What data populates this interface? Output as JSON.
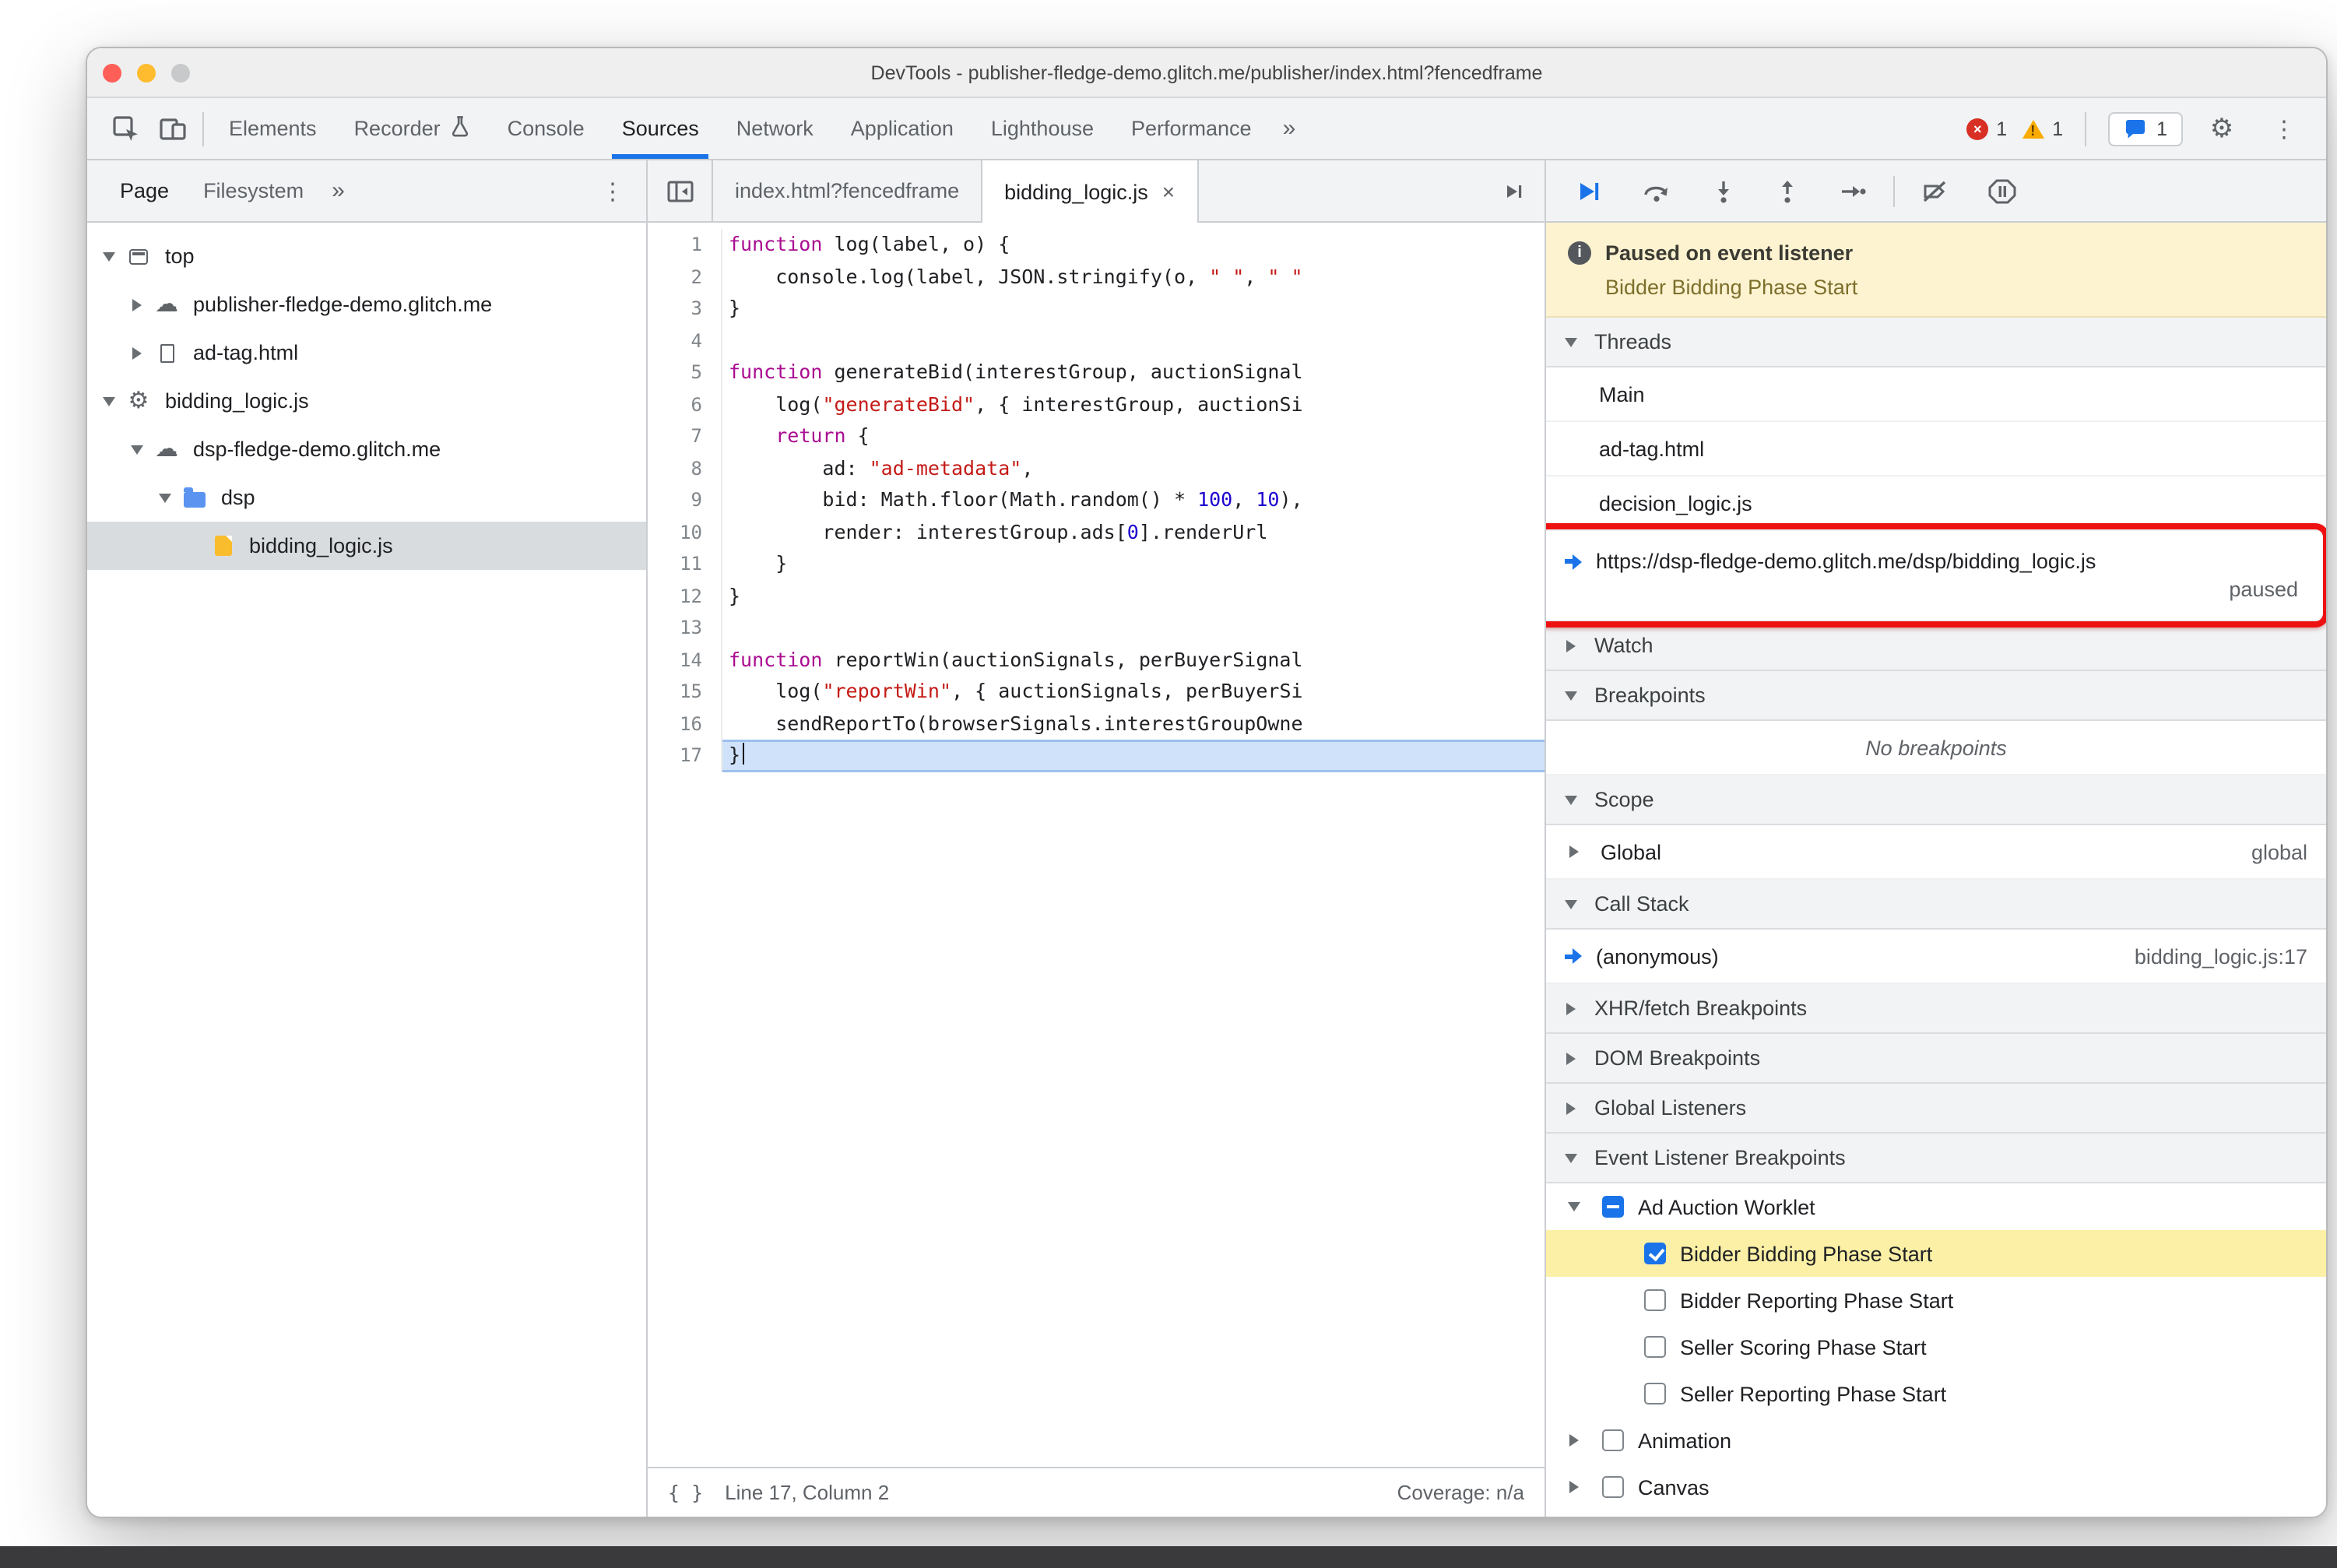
{
  "window": {
    "title": "DevTools - publisher-fledge-demo.glitch.me/publisher/index.html?fencedframe"
  },
  "toolbar": {
    "left_icons": [
      "inspect-element",
      "toggle-device-toolbar"
    ],
    "tabs": [
      {
        "label": "Elements"
      },
      {
        "label": "Recorder",
        "icon": "flask"
      },
      {
        "label": "Console"
      },
      {
        "label": "Sources",
        "active": true
      },
      {
        "label": "Network"
      },
      {
        "label": "Application"
      },
      {
        "label": "Lighthouse"
      },
      {
        "label": "Performance"
      }
    ],
    "more_label": "»",
    "error_count": "1",
    "warning_count": "1",
    "issues_count": "1"
  },
  "navigator": {
    "tabs": [
      "Page",
      "Filesystem"
    ],
    "more_label": "»",
    "tree": [
      {
        "label": "top",
        "icon": "frame",
        "level": 0,
        "expander": "open"
      },
      {
        "label": "publisher-fledge-demo.glitch.me",
        "icon": "cloud",
        "level": 1,
        "expander": "closed"
      },
      {
        "label": "ad-tag.html",
        "icon": "doc",
        "level": 1,
        "expander": "closed"
      },
      {
        "label": "bidding_logic.js",
        "icon": "gear",
        "level": 0,
        "expander": "open"
      },
      {
        "label": "dsp-fledge-demo.glitch.me",
        "icon": "cloud",
        "level": 1,
        "expander": "open"
      },
      {
        "label": "dsp",
        "icon": "folder",
        "level": 2,
        "expander": "open"
      },
      {
        "label": "bidding_logic.js",
        "icon": "file",
        "level": 3,
        "expander": "none",
        "selected": true
      }
    ]
  },
  "editor": {
    "tabs": [
      {
        "label": "index.html?fencedframe"
      },
      {
        "label": "bidding_logic.js",
        "active": true,
        "closable": true
      }
    ],
    "current_line": 17,
    "lines": [
      [
        {
          "c": "k",
          "t": "function"
        },
        {
          "c": "d",
          "t": " log(label, o) {"
        }
      ],
      [
        {
          "c": "d",
          "t": "    console.log(label, JSON.stringify(o, "
        },
        {
          "c": "s",
          "t": "\" \""
        },
        {
          "c": "d",
          "t": ", "
        },
        {
          "c": "s",
          "t": "\" \""
        }
      ],
      [
        {
          "c": "d",
          "t": "}"
        }
      ],
      [],
      [
        {
          "c": "k",
          "t": "function"
        },
        {
          "c": "d",
          "t": " generateBid(interestGroup, auctionSignal"
        }
      ],
      [
        {
          "c": "d",
          "t": "    log("
        },
        {
          "c": "s",
          "t": "\"generateBid\""
        },
        {
          "c": "d",
          "t": ", { interestGroup, auctionSi"
        }
      ],
      [
        {
          "c": "d",
          "t": "    "
        },
        {
          "c": "k",
          "t": "return"
        },
        {
          "c": "d",
          "t": " {"
        }
      ],
      [
        {
          "c": "d",
          "t": "        ad: "
        },
        {
          "c": "s",
          "t": "\"ad-metadata\""
        },
        {
          "c": "d",
          "t": ","
        }
      ],
      [
        {
          "c": "d",
          "t": "        bid: Math.floor(Math.random() * "
        },
        {
          "c": "n",
          "t": "100"
        },
        {
          "c": "d",
          "t": ", "
        },
        {
          "c": "n",
          "t": "10"
        },
        {
          "c": "d",
          "t": "),"
        }
      ],
      [
        {
          "c": "d",
          "t": "        render: interestGroup.ads["
        },
        {
          "c": "n",
          "t": "0"
        },
        {
          "c": "d",
          "t": "].renderUrl"
        }
      ],
      [
        {
          "c": "d",
          "t": "    }"
        }
      ],
      [
        {
          "c": "d",
          "t": "}"
        }
      ],
      [],
      [
        {
          "c": "k",
          "t": "function"
        },
        {
          "c": "d",
          "t": " reportWin(auctionSignals, perBuyerSignal"
        }
      ],
      [
        {
          "c": "d",
          "t": "    log("
        },
        {
          "c": "s",
          "t": "\"reportWin\""
        },
        {
          "c": "d",
          "t": ", { auctionSignals, perBuyerSi"
        }
      ],
      [
        {
          "c": "d",
          "t": "    sendReportTo(browserSignals.interestGroupOwne"
        }
      ],
      [
        {
          "c": "d",
          "t": "}"
        }
      ]
    ],
    "status": {
      "position": "Line 17, Column 2",
      "coverage": "Coverage: n/a"
    }
  },
  "debugger": {
    "toolbar_icons": [
      "resume",
      "step-over",
      "step-into",
      "step-out",
      "step",
      "deactivate-breakpoints",
      "pause-on-exceptions"
    ],
    "paused": {
      "title": "Paused on event listener",
      "subtitle": "Bidder Bidding Phase Start"
    },
    "threads": {
      "title": "Threads",
      "items": [
        {
          "label": "Main"
        },
        {
          "label": "ad-tag.html"
        },
        {
          "label": "decision_logic.js"
        },
        {
          "label": "https://dsp-fledge-demo.glitch.me/dsp/bidding_logic.js",
          "current": true,
          "status": "paused"
        }
      ]
    },
    "watch": {
      "title": "Watch"
    },
    "breakpoints": {
      "title": "Breakpoints",
      "empty": "No breakpoints"
    },
    "scope": {
      "title": "Scope",
      "rows": [
        {
          "label": "Global",
          "value": "global"
        }
      ]
    },
    "call_stack": {
      "title": "Call Stack",
      "rows": [
        {
          "label": "(anonymous)",
          "location": "bidding_logic.js:17",
          "current": true
        }
      ]
    },
    "xhr_breakpoints": {
      "title": "XHR/fetch Breakpoints"
    },
    "dom_breakpoints": {
      "title": "DOM Breakpoints"
    },
    "global_listeners": {
      "title": "Global Listeners"
    },
    "event_listener_breakpoints": {
      "title": "Event Listener Breakpoints",
      "categories": [
        {
          "label": "Ad Auction Worklet",
          "state": "indeterminate",
          "expanded": true,
          "children": [
            {
              "label": "Bidder Bidding Phase Start",
              "checked": true,
              "highlighted": true
            },
            {
              "label": "Bidder Reporting Phase Start",
              "checked": false
            },
            {
              "label": "Seller Scoring Phase Start",
              "checked": false
            },
            {
              "label": "Seller Reporting Phase Start",
              "checked": false
            }
          ]
        },
        {
          "label": "Animation",
          "state": "unchecked",
          "expanded": false
        },
        {
          "label": "Canvas",
          "state": "unchecked",
          "expanded": false
        }
      ]
    }
  },
  "colors": {
    "accent": "#1a73e8",
    "annot": "#ee1111",
    "banner": "#fdf3d1",
    "bannersub": "#7d6f2b",
    "hit": "#fbf0a6",
    "linehl": "#cfe2f9",
    "kw": "#aa0d91",
    "str": "#c41a16",
    "num": "#1c00cf",
    "folder": "#5b94f0",
    "file": "#f9bc2d",
    "error": "#d93025",
    "warning": "#f9ab00",
    "strip": "#3a3a3c"
  }
}
